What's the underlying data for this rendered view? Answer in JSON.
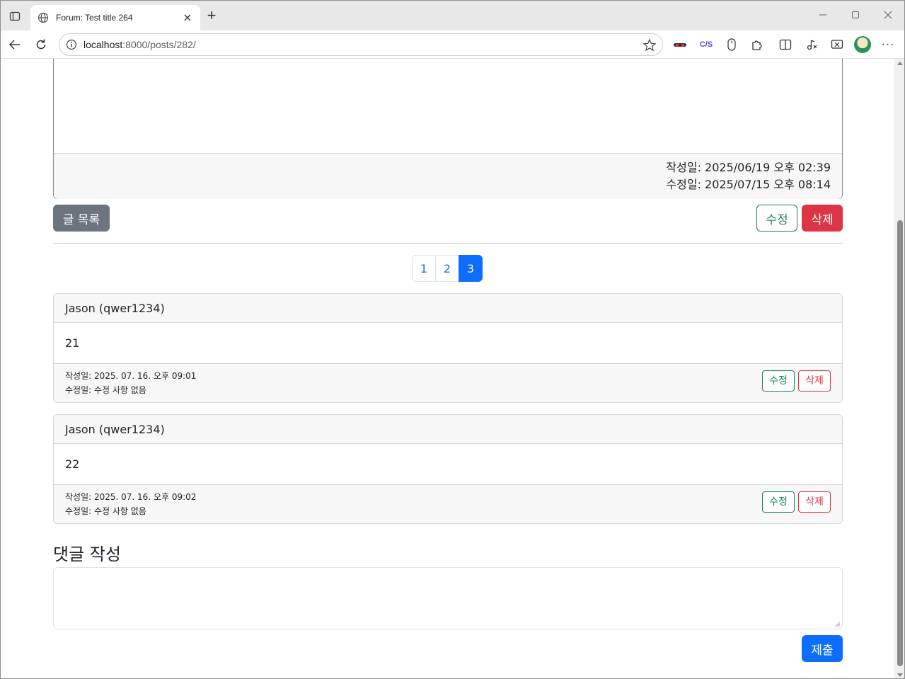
{
  "browser": {
    "tab_title": "Forum: Test title 264",
    "url_host": "localhost",
    "url_path": ":8000/posts/282/"
  },
  "post": {
    "created": "작성일: 2025/06/19 오후 02:39",
    "modified": "수정일: 2025/07/15 오후 08:14"
  },
  "actions": {
    "list_label": "글 목록",
    "edit_label": "수정",
    "delete_label": "삭제"
  },
  "pagination": {
    "pages": [
      "1",
      "2",
      "3"
    ],
    "active": "3"
  },
  "comments": [
    {
      "author": "Jason (qwer1234)",
      "content": "21",
      "created": "작성일: 2025. 07. 16. 오후 09:01",
      "modified": "수정일: 수정 사항 없음",
      "edit_label": "수정",
      "delete_label": "삭제"
    },
    {
      "author": "Jason (qwer1234)",
      "content": "22",
      "created": "작성일: 2025. 07. 16. 오후 09:02",
      "modified": "수정일: 수정 사항 없음",
      "edit_label": "수정",
      "delete_label": "삭제"
    }
  ],
  "comment_form": {
    "title": "댓글 작성",
    "placeholder": "",
    "submit_label": "제출"
  },
  "colors": {
    "primary": "#0d6efd",
    "secondary": "#6c757d",
    "success": "#198754",
    "danger": "#dc3545"
  }
}
